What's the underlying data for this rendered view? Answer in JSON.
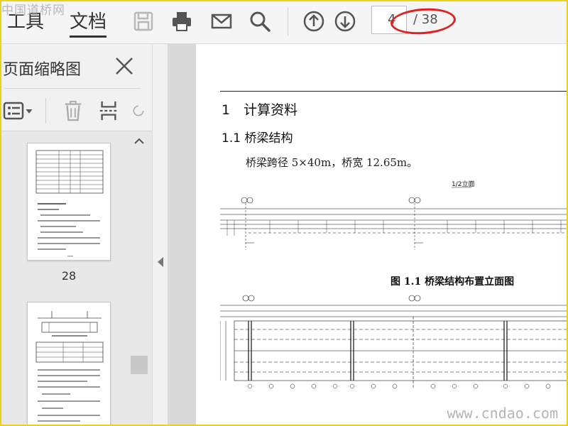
{
  "watermark": {
    "top": "中国道桥网",
    "bottom": "www.cndao.com"
  },
  "toolbar": {
    "tab_tools": "工具",
    "tab_document": "文档",
    "current_page": "4",
    "total_pages": "/ 38",
    "icons": [
      "save-icon",
      "print-icon",
      "mail-icon",
      "search-icon",
      "page-up-icon",
      "page-down-icon"
    ]
  },
  "sidebar": {
    "title": "页面缩略图",
    "thumbnails": [
      {
        "label": "28"
      }
    ]
  },
  "document": {
    "heading1": "1　计算资料",
    "heading2": "1.1  桥梁结构",
    "paragraph": "桥梁跨径 5×40m，桥宽 12.65m。",
    "figure_caption": "图  1.1 桥梁结构布置立面图",
    "drawing_title": "1/2立面"
  },
  "colors": {
    "accent": "#e02020",
    "frame": "#e9d21a"
  }
}
